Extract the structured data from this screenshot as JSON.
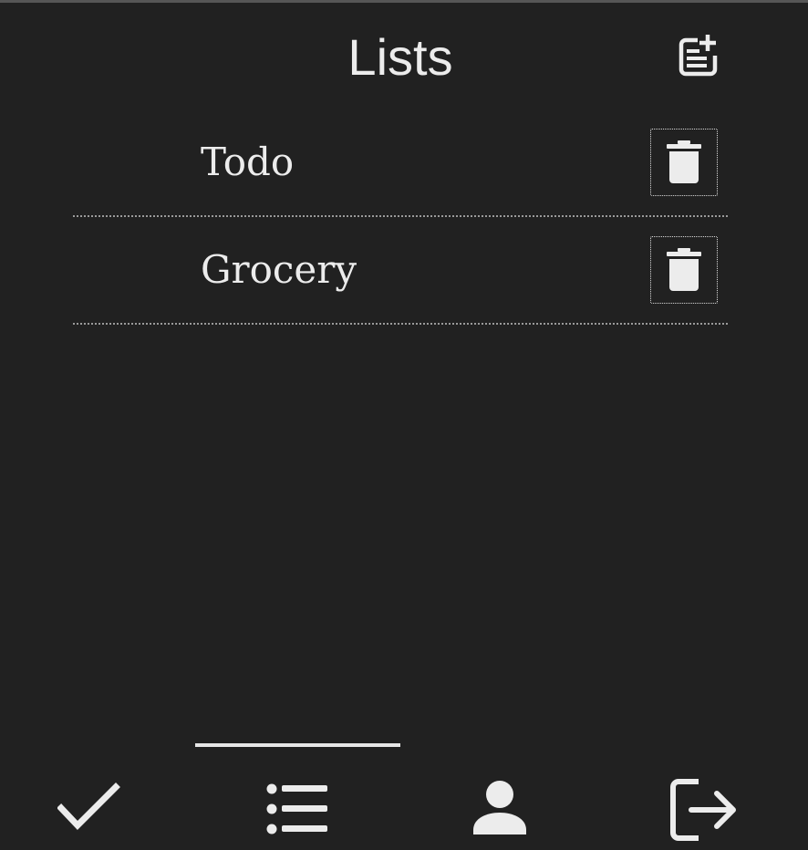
{
  "header": {
    "title": "Lists",
    "add_icon": "note-add-icon"
  },
  "lists": [
    {
      "name": "Todo",
      "delete_icon": "trash-icon"
    },
    {
      "name": "Grocery",
      "delete_icon": "trash-icon"
    }
  ],
  "bottom_nav": {
    "active_index": 1,
    "items": [
      {
        "icon": "checkmark-icon"
      },
      {
        "icon": "list-icon"
      },
      {
        "icon": "person-icon"
      },
      {
        "icon": "logout-icon"
      }
    ]
  },
  "colors": {
    "background": "#212121",
    "text": "#ececec",
    "divider": "#9a9a9a",
    "top_strip": "#565656"
  }
}
